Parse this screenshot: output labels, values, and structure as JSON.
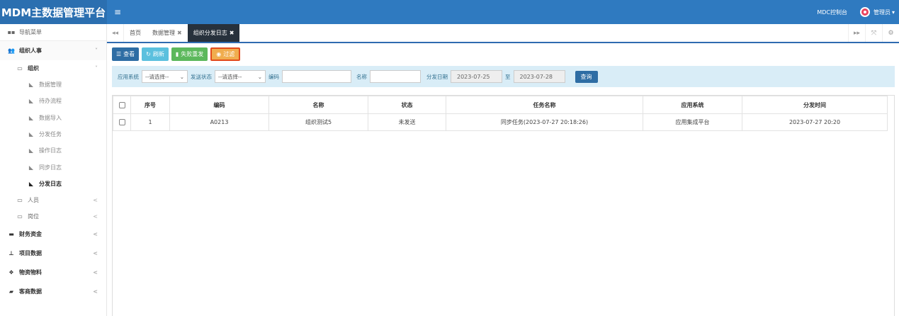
{
  "header": {
    "brand": "MDM主数据管理平台",
    "menu_toggle": "≡",
    "mdc_link": "MDC控制台",
    "user": "管理员",
    "user_caret": "▾"
  },
  "sidebar": {
    "title": "导航菜单",
    "items": [
      {
        "label": "组织人事",
        "level": 1,
        "arrow": "˅"
      },
      {
        "label": "组织",
        "level": 2,
        "arrow": "˅"
      },
      {
        "label": "数据管理",
        "level": 3
      },
      {
        "label": "待办流程",
        "level": 3
      },
      {
        "label": "数据导入",
        "level": 3
      },
      {
        "label": "分发任务",
        "level": 3
      },
      {
        "label": "操作日志",
        "level": 3
      },
      {
        "label": "同步日志",
        "level": 3
      },
      {
        "label": "分发日志",
        "level": 3,
        "active": true
      },
      {
        "label": "人员",
        "level": 2,
        "arrow": "<"
      },
      {
        "label": "岗位",
        "level": 2,
        "arrow": "<"
      },
      {
        "label": "财务资金",
        "level": 1,
        "arrow": "<"
      },
      {
        "label": "项目数据",
        "level": 1,
        "arrow": "<"
      },
      {
        "label": "物资物料",
        "level": 1,
        "arrow": "<"
      },
      {
        "label": "客商数据",
        "level": 1,
        "arrow": "<"
      }
    ]
  },
  "tabs": {
    "items": [
      {
        "label": "首页"
      },
      {
        "label": "数据管理",
        "close": "✖"
      },
      {
        "label": "组织分发日志",
        "close": "✖",
        "active": true
      }
    ]
  },
  "toolbar": {
    "view": "查看",
    "refresh": "刷新",
    "resend": "失败重发",
    "filter": "过滤"
  },
  "search": {
    "app_system_label": "应用系统",
    "app_system_value": "--请选择--",
    "status_label": "发送状态",
    "status_value": "--请选择--",
    "code_label": "编码",
    "name_label": "名称",
    "date_label": "分发日期",
    "date_from": "2023-07-25",
    "date_to_label": "至",
    "date_to": "2023-07-28",
    "query_button": "查询"
  },
  "table": {
    "headers": [
      "序号",
      "编码",
      "名称",
      "状态",
      "任务名称",
      "应用系统",
      "分发时间"
    ],
    "rows": [
      [
        "1",
        "A0213",
        "组织测试5",
        "未发送",
        "同步任务(2023-07-27 20:18:26)",
        "应用集成平台",
        "2023-07-27 20:20"
      ]
    ]
  }
}
